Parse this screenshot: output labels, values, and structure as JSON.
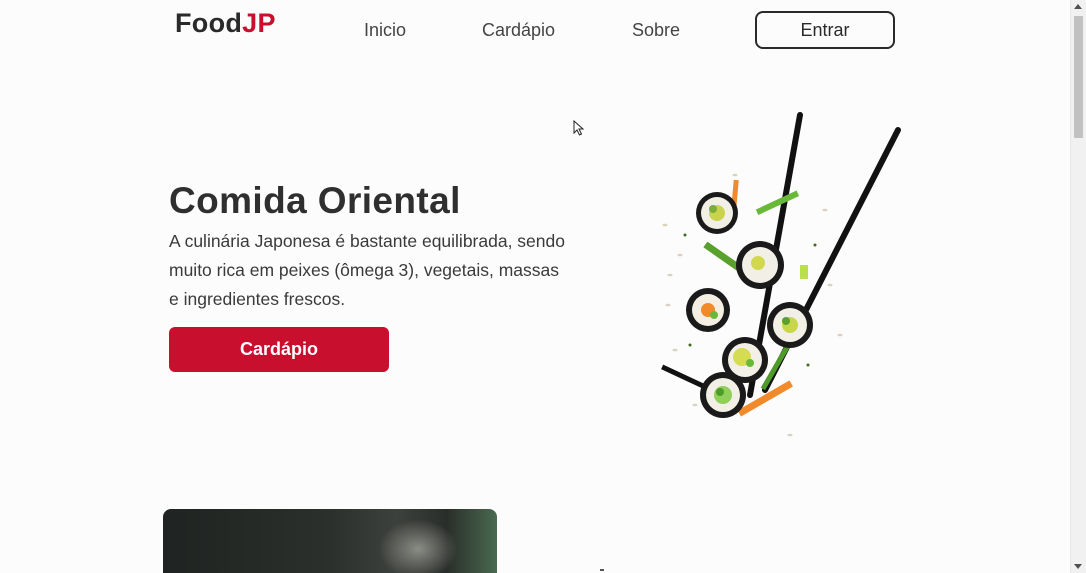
{
  "nav": {
    "logo_main": "Food",
    "logo_accent": "JP",
    "links": [
      "Inicio",
      "Cardápio",
      "Sobre"
    ],
    "login_label": "Entrar"
  },
  "hero": {
    "title": "Comida Oriental",
    "description": "A culinária Japonesa é bastante equilibrada, sendo muito rica em peixes (ômega 3), vegetais, massas e ingredientes frescos.",
    "cta_label": "Cardápio",
    "image_subject": "sushi-with-chopsticks"
  },
  "colors": {
    "brand_red": "#c8102e",
    "text_dark": "#2f2f2f",
    "background": "#fdfcfc"
  }
}
